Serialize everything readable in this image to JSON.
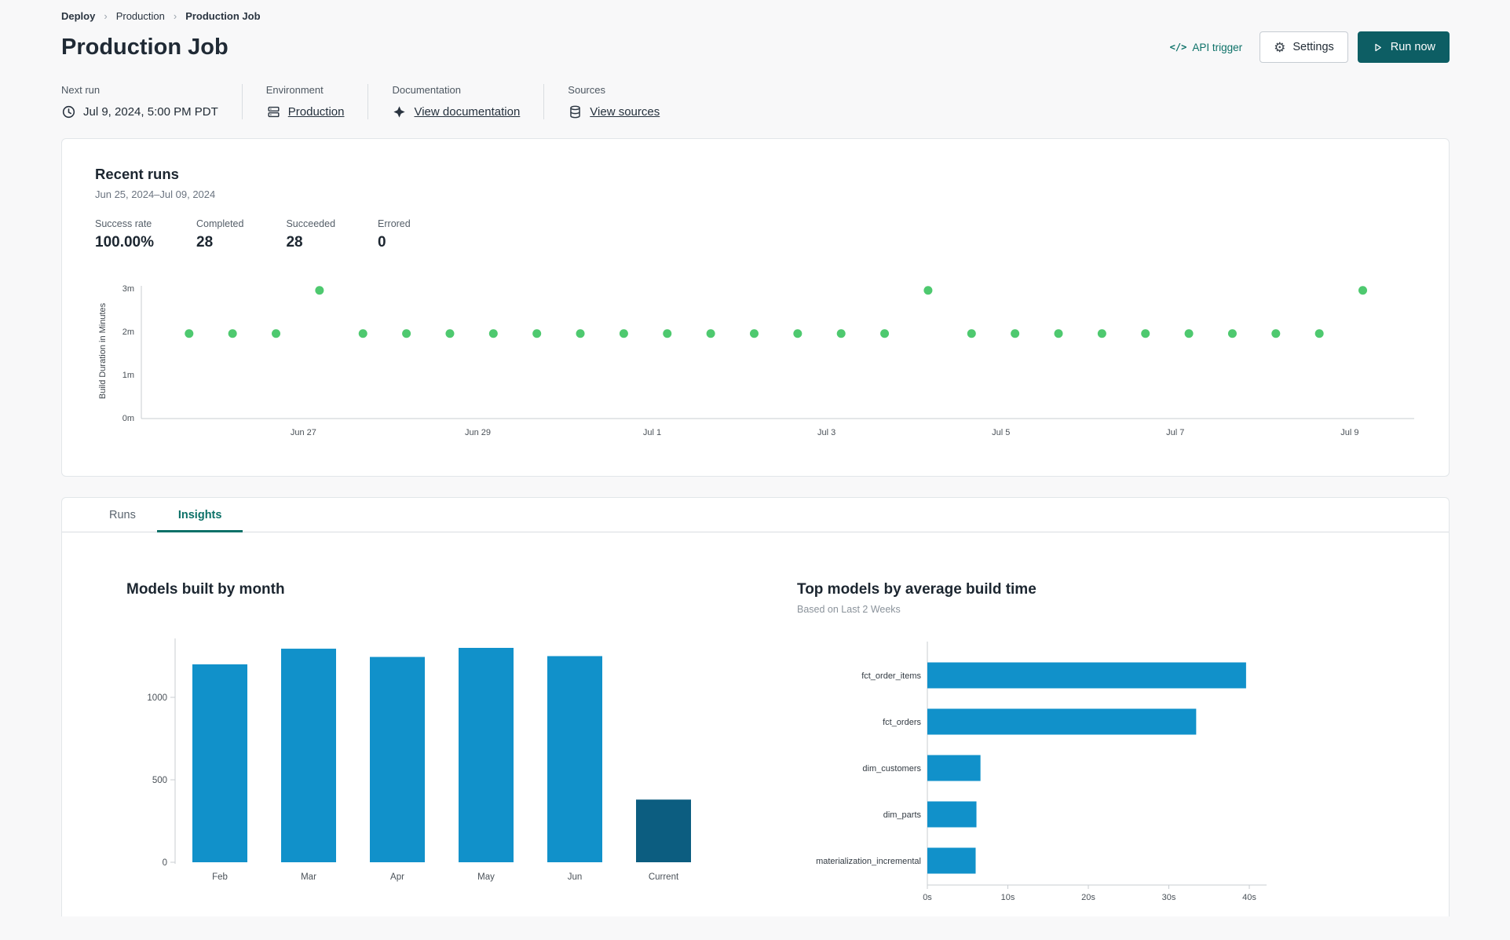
{
  "breadcrumb": {
    "items": [
      {
        "label": "Deploy"
      },
      {
        "label": "Production"
      },
      {
        "label": "Production Job"
      }
    ]
  },
  "header": {
    "title": "Production Job",
    "actions": {
      "code_glyph": "</>",
      "api_trigger": "API trigger",
      "settings": "Settings",
      "run_now": "Run now"
    }
  },
  "meta": {
    "next_run": {
      "label": "Next run",
      "value": "Jul 9, 2024, 5:00 PM PDT"
    },
    "environment": {
      "label": "Environment",
      "link": "Production"
    },
    "documentation": {
      "label": "Documentation",
      "link": "View documentation"
    },
    "sources": {
      "label": "Sources",
      "link": "View sources"
    }
  },
  "recent_runs": {
    "title": "Recent runs",
    "date_range": "Jun 25, 2024–Jul 09, 2024",
    "stats": [
      {
        "label": "Success rate",
        "value": "100.00%"
      },
      {
        "label": "Completed",
        "value": "28"
      },
      {
        "label": "Succeeded",
        "value": "28"
      },
      {
        "label": "Errored",
        "value": "0"
      }
    ]
  },
  "tabs": [
    {
      "label": "Runs",
      "active": false
    },
    {
      "label": "Insights",
      "active": true
    }
  ],
  "colors": {
    "accent_teal": "#0c7168",
    "button_teal": "#0d5e64",
    "dot_green": "#4ec96f",
    "bar_blue": "#1191ca",
    "bar_dark_blue": "#0c5d80"
  },
  "chart_data": [
    {
      "id": "build_duration_scatter",
      "type": "scatter",
      "title": "Recent runs",
      "ylabel": "Build Duration in Minutes",
      "ylim": [
        0,
        3.2
      ],
      "y_tick_labels": [
        "0m",
        "1m",
        "2m",
        "3m"
      ],
      "x_tick_labels": [
        "Jun 27",
        "Jun 29",
        "Jul 1",
        "Jul 3",
        "Jul 5",
        "Jul 7",
        "Jul 9"
      ],
      "points_minutes": [
        1.95,
        1.95,
        1.95,
        2.95,
        1.95,
        1.95,
        1.95,
        1.95,
        1.95,
        1.95,
        1.95,
        1.95,
        1.95,
        1.95,
        1.95,
        1.95,
        1.95,
        2.95,
        1.95,
        1.95,
        1.95,
        1.95,
        1.95,
        1.95,
        1.95,
        1.95,
        1.95,
        2.95
      ],
      "point_color": "#4ec96f",
      "grid": false,
      "legend": false
    },
    {
      "id": "models_built_by_month",
      "type": "bar",
      "title": "Models built by month",
      "categories": [
        "Feb",
        "Mar",
        "Apr",
        "May",
        "Jun",
        "Current"
      ],
      "values": [
        1200,
        1295,
        1245,
        1300,
        1250,
        380
      ],
      "y_ticks": [
        0,
        500,
        1000
      ],
      "ylim": [
        0,
        1400
      ],
      "bar_color": "#1191ca",
      "last_bar_color": "#0c5d80",
      "grid": false,
      "legend": false
    },
    {
      "id": "top_models_by_build_time",
      "type": "hbar",
      "title": "Top models by average build time",
      "subtitle": "Based on Last 2 Weeks",
      "categories": [
        "fct_order_items",
        "fct_orders",
        "dim_customers",
        "dim_parts",
        "materialization_incremental"
      ],
      "values_seconds": [
        39.6,
        33.4,
        6.6,
        6.1,
        6.0
      ],
      "x_ticks": [
        0,
        10,
        20,
        30,
        40
      ],
      "x_tick_labels": [
        "0s",
        "10s",
        "20s",
        "30s",
        "40s"
      ],
      "xlim": [
        0,
        42
      ],
      "bar_color": "#1191ca",
      "grid": false,
      "legend": false
    }
  ]
}
